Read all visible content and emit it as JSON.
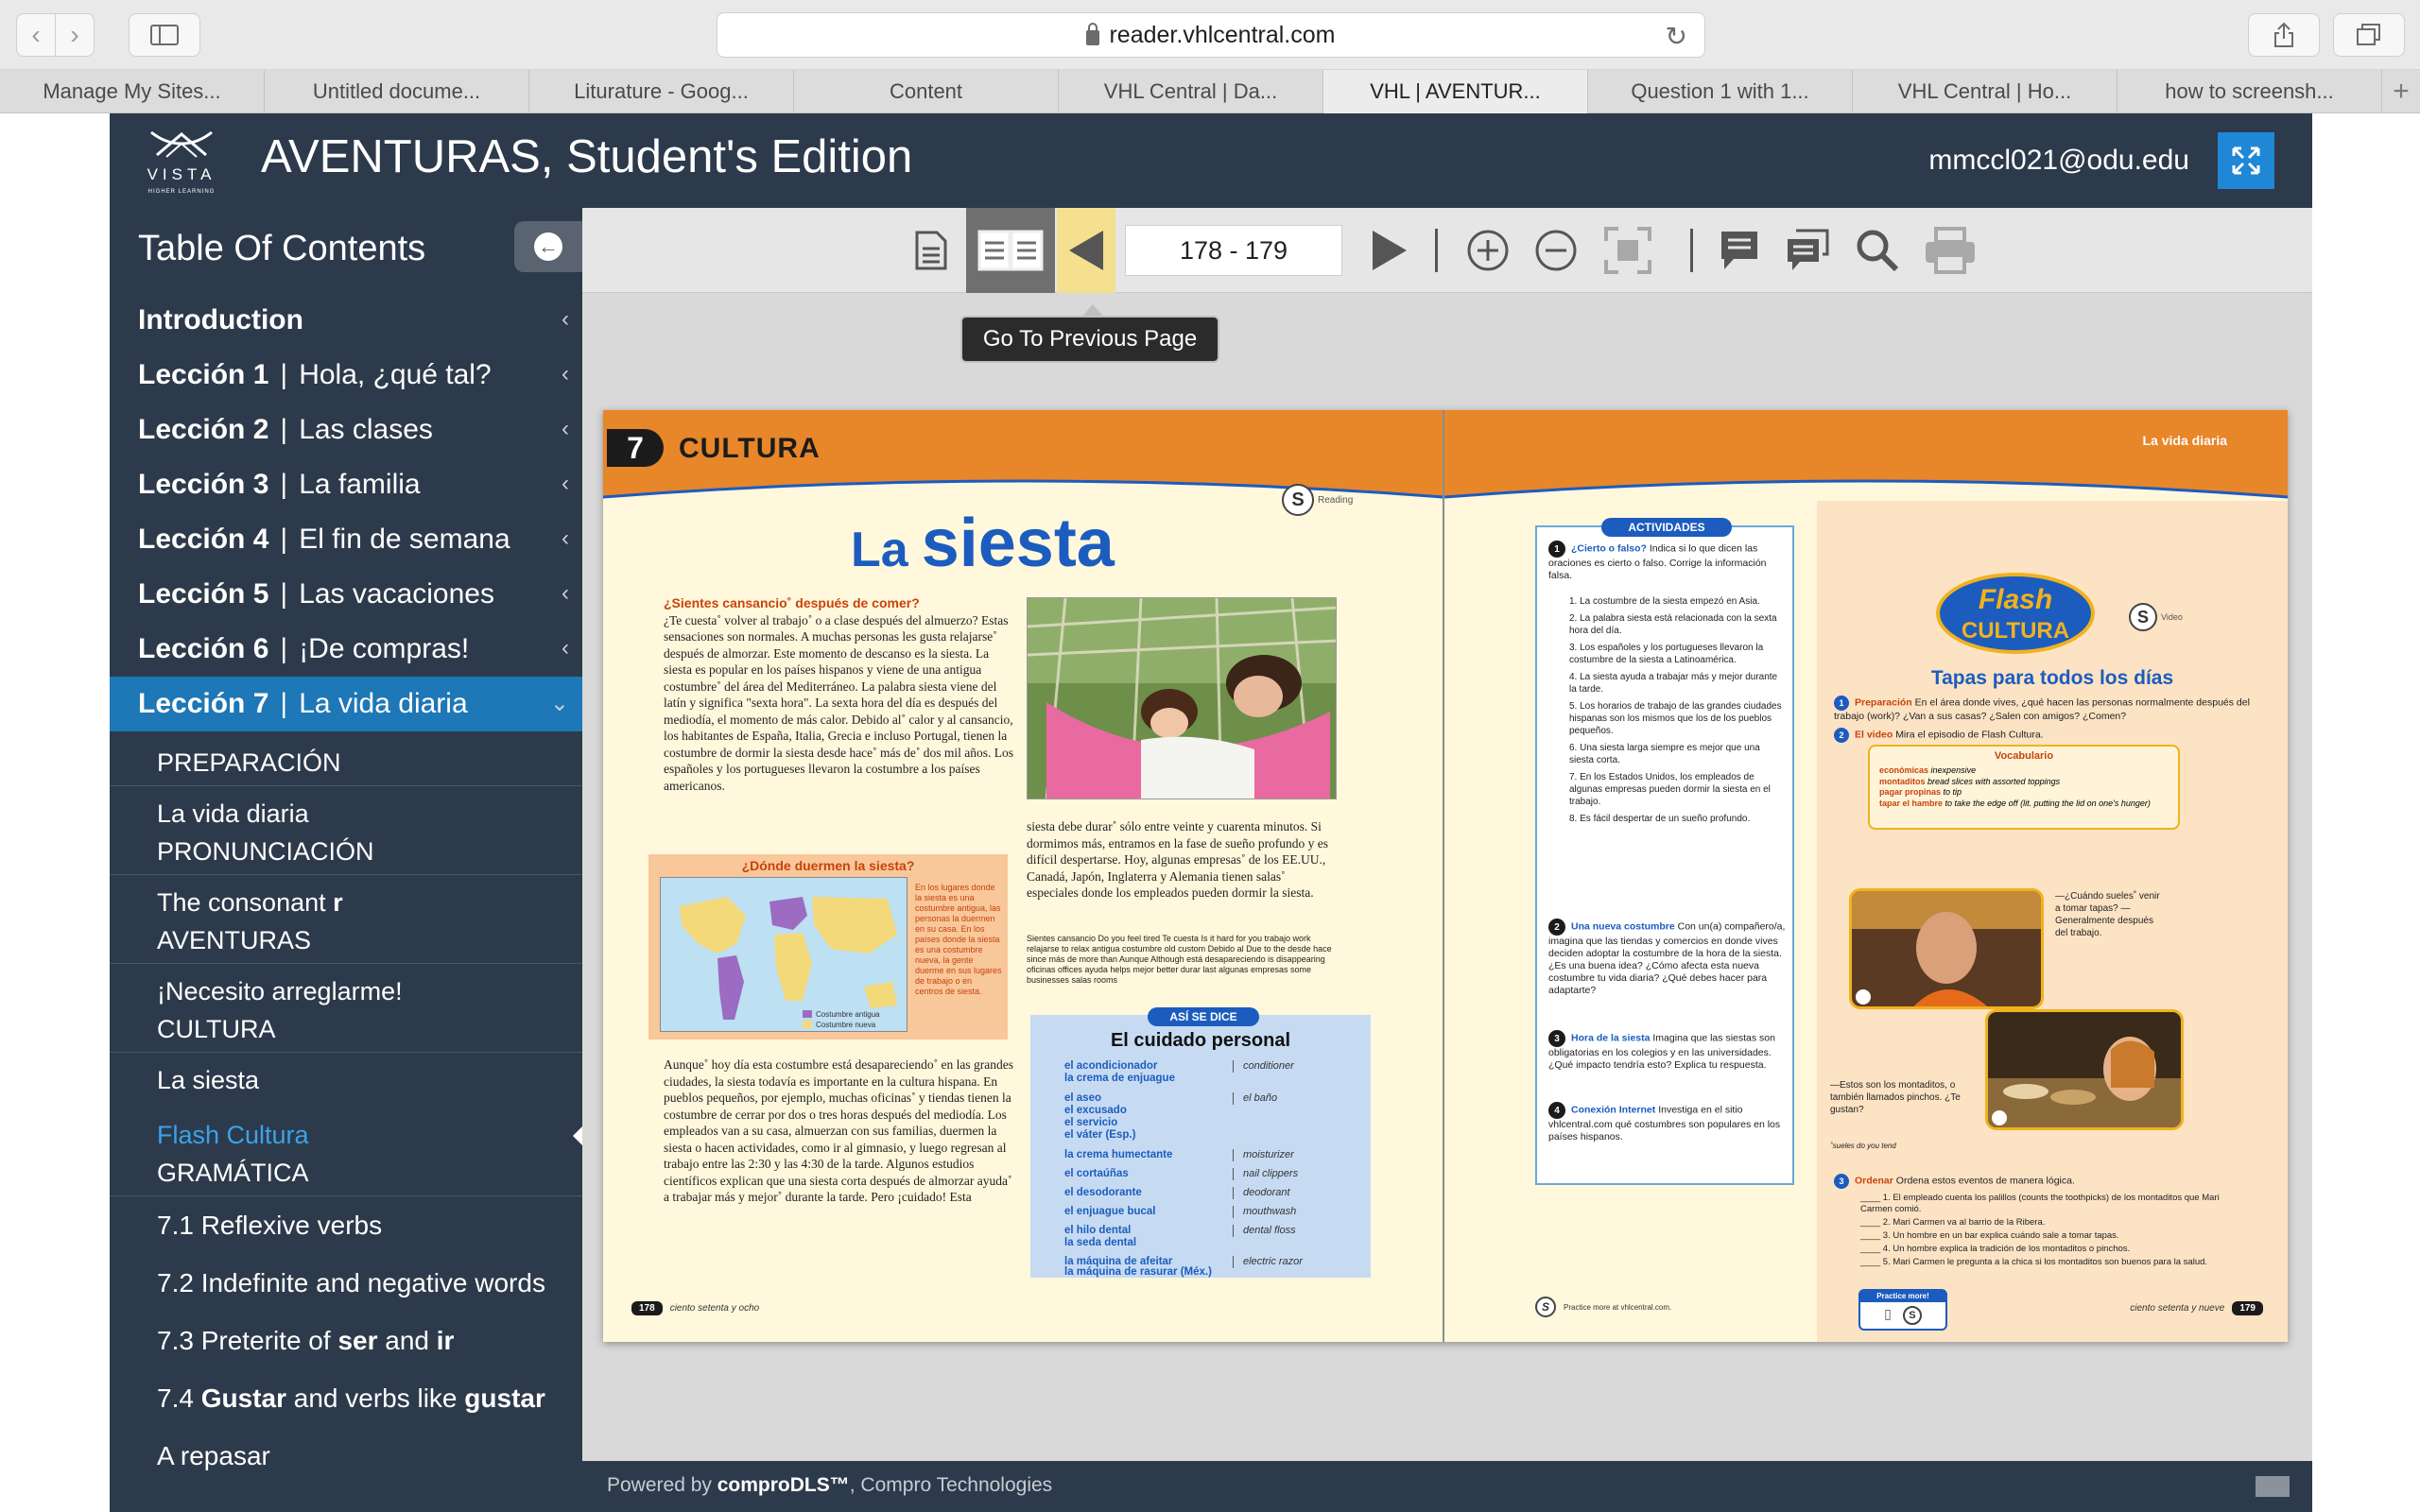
{
  "browser": {
    "url": "reader.vhlcentral.com",
    "tabs": [
      {
        "label": "Manage My Sites..."
      },
      {
        "label": "Untitled docume..."
      },
      {
        "label": "Liturature - Goog..."
      },
      {
        "label": "Content"
      },
      {
        "label": "VHL Central | Da..."
      },
      {
        "label": "VHL | AVENTUR..."
      },
      {
        "label": "Question 1 with 1..."
      },
      {
        "label": "VHL Central | Ho..."
      },
      {
        "label": "how to screensh..."
      }
    ],
    "active_tab_index": 5
  },
  "header": {
    "logo_text": "VISTA",
    "logo_subtext": "HIGHER LEARNING",
    "title": "AVENTURAS, Student's Edition",
    "user_email": "mmccl021@odu.edu"
  },
  "sidebar": {
    "title": "Table Of Contents",
    "lessons": [
      {
        "bold": "Introduction",
        "name": ""
      },
      {
        "bold": "Lección 1",
        "name": "Hola, ¿qué tal?"
      },
      {
        "bold": "Lección 2",
        "name": "Las clases"
      },
      {
        "bold": "Lección 3",
        "name": "La familia"
      },
      {
        "bold": "Lección 4",
        "name": "El fin de semana"
      },
      {
        "bold": "Lección 5",
        "name": "Las vacaciones"
      },
      {
        "bold": "Lección 6",
        "name": "¡De compras!"
      },
      {
        "bold": "Lección 7",
        "name": "La vida diaria"
      }
    ],
    "sections": {
      "preparacion": "PREPARACIÓN",
      "vida_diaria": "La vida diaria",
      "pronunciacion": "PRONUNCIACIÓN",
      "consonant_pre": "The consonant",
      "consonant_bold": "r",
      "aventuras": "AVENTURAS",
      "necesito": "¡Necesito arreglarme!",
      "cultura": "CULTURA",
      "la_siesta": "La siesta",
      "flash_cultura": "Flash Cultura",
      "gramatica": "GRAMÁTICA",
      "g71": "7.1 Reflexive verbs",
      "g72": "7.2 Indefinite and negative words",
      "g73_pre": "7.3 Preterite of",
      "g73_b1": "ser",
      "g73_mid": "and",
      "g73_b2": "ir",
      "g74_pre": "7.4",
      "g74_b1": "Gustar",
      "g74_mid": "and verbs like",
      "g74_b2": "gustar",
      "repasar": "A repasar"
    }
  },
  "reader": {
    "page_range": "178 - 179",
    "tooltip": "Go To Previous Page"
  },
  "book": {
    "left": {
      "lesson_number": "7",
      "section": "CULTURA",
      "reading_label": "Reading",
      "headline_la": "La",
      "headline_main": "siesta",
      "lead_question": "¿Sientes cansancio˚ después de comer?",
      "col1": "¿Te cuesta˚ volver al trabajo˚ o a clase después del almuerzo? Estas sensaciones son normales. A muchas personas les gusta relajarse˚ después de almorzar. Este momento de descanso es la siesta. La siesta es popular en los países hispanos y viene de una antigua costumbre˚ del área del Mediterráneo. La palabra siesta viene del latín y significa \"sexta hora\". La sexta hora del día es después del mediodía, el momento de más calor. Debido al˚ calor y al cansancio, los habitantes de España, Italia, Grecia e incluso Portugal, tienen la costumbre de dormir la siesta desde hace˚ más de˚ dos mil años. Los españoles y los portugueses llevaron la costumbre a los países americanos.",
      "col2": "siesta debe durar˚ sólo entre veinte y cuarenta minutos. Si dormimos más, entramos en la fase de sueño profundo y es difícil despertarse. Hoy, algunas empresas˚ de los EE.UU., Canadá, Japón, Inglaterra y Alemania tienen salas˚ especiales donde los empleados pueden dormir la siesta.",
      "glossary": "Sientes cansancio Do you feel tired Te cuesta Is it hard for you trabajo work relajarse to relax antigua costumbre old custom Debido al Due to the desde hace since más de more than Aunque Although está desapareciendo is disappearing oficinas offices ayuda helps mejor better durar last algunas empresas some businesses salas rooms",
      "map_title": "¿Dónde duermen la siesta?",
      "map_caption": "En los lugares donde la siesta es una costumbre antigua, las personas la duermen en su casa. En los países donde la siesta es una costumbre nueva, la gente duerme en sus lugares de trabajo o en centros de siesta.",
      "map_legend_1": "Costumbre antigua",
      "map_legend_2": "Costumbre nueva",
      "col3": "Aunque˚ hoy día esta costumbre está desapareciendo˚ en las grandes ciudades, la siesta todavía es importante en la cultura hispana. En pueblos pequeños, por ejemplo, muchas oficinas˚ y tiendas tienen la costumbre de cerrar por dos o tres horas después del mediodía. Los empleados van a su casa, almuerzan con sus familias, duermen la siesta o hacen actividades, como ir al gimnasio, y luego regresan al trabajo entre las 2:30 y las 4:30 de la tarde. Algunos estudios científicos explican que una siesta corta después de almorzar ayuda˚ a trabajar más y mejor˚ durante la tarde. Pero ¡cuidado! Esta",
      "asi_tag": "ASÍ SE DICE",
      "asi_title": "El cuidado personal",
      "asi_rows": [
        {
          "es": "el acondicionador",
          "en": "conditioner"
        },
        {
          "es": "la crema de enjuague",
          "en": ""
        },
        {
          "es": "el aseo",
          "en": "el baño"
        },
        {
          "es": "el excusado",
          "en": ""
        },
        {
          "es": "el servicio",
          "en": ""
        },
        {
          "es": "el váter (Esp.)",
          "en": ""
        },
        {
          "es": "la crema humectante",
          "en": "moisturizer"
        },
        {
          "es": "el cortaúñas",
          "en": "nail clippers"
        },
        {
          "es": "el desodorante",
          "en": "deodorant"
        },
        {
          "es": "el enjuague bucal",
          "en": "mouthwash"
        },
        {
          "es": "el hilo dental",
          "en": "dental floss"
        },
        {
          "es": "la seda dental",
          "en": ""
        },
        {
          "es": "la máquina de afeitar",
          "en": "electric razor"
        },
        {
          "es": "la máquina de rasurar (Méx.)",
          "en": ""
        }
      ],
      "page_number": "178",
      "page_words": "ciento setenta y ocho"
    },
    "right": {
      "band_title": "La vida diaria",
      "actividades_tag": "ACTIVIDADES",
      "act1_title": "¿Cierto o falso?",
      "act1_text": "Indica si lo que dicen las oraciones es cierto o falso. Corrige la información falsa.",
      "act1_items": [
        "1. La costumbre de la siesta empezó en Asia.",
        "2. La palabra siesta está relacionada con la sexta hora del día.",
        "3. Los españoles y los portugueses llevaron la costumbre de la siesta a Latinoamérica.",
        "4. La siesta ayuda a trabajar más y mejor durante la tarde.",
        "5. Los horarios de trabajo de las grandes ciudades hispanas son los mismos que los de los pueblos pequeños.",
        "6. Una siesta larga siempre es mejor que una siesta corta.",
        "7. En los Estados Unidos, los empleados de algunas empresas pueden dormir la siesta en el trabajo.",
        "8. Es fácil despertar de un sueño profundo."
      ],
      "act2_title": "Una nueva costumbre",
      "act2_text": "Con un(a) compañero/a, imagina que las tiendas y comercios en donde vives deciden adoptar la costumbre de la hora de la siesta. ¿Es una buena idea? ¿Cómo afecta esta nueva costumbre tu vida diaria? ¿Qué debes hacer para adaptarte?",
      "act3_title": "Hora de la siesta",
      "act3_text": "Imagina que las siestas son obligatorias en los colegios y en las universidades. ¿Qué impacto tendría esto? Explica tu respuesta.",
      "act4_title": "Conexión Internet",
      "act4_text": "Investiga en el sitio vhlcentral.com qué costumbres son populares en los países hispanos.",
      "practice_note": "Practice more at vhlcentral.com.",
      "flash_logo_1": "Flash",
      "flash_logo_2": "CULTURA",
      "video_label": "Video",
      "flash_title": "Tapas para todos los días",
      "prep_title": "Preparación",
      "prep_text": "En el área donde vives, ¿qué hacen las personas normalmente después del trabajo (work)? ¿Van a sus casas? ¿Salen con amigos? ¿Comen?",
      "video_title": "El video",
      "video_text": "Mira el episodio de Flash Cultura.",
      "vocab_title": "Vocabulario",
      "vocab_rows": [
        {
          "es": "económicas",
          "en": "inexpensive"
        },
        {
          "es": "montaditos",
          "en": "bread slices with assorted toppings"
        },
        {
          "es": "pagar propinas",
          "en": "to tip"
        },
        {
          "es": "tapar el hambre",
          "en": "to take the edge off (lit. putting the lid on one's hunger)"
        }
      ],
      "quote1": "—¿Cuándo sueles˚ venir a tomar tapas? —Generalmente después del trabajo.",
      "quote2": "—Estos son los montaditos, o también llamados pinchos. ¿Te gustan?",
      "suele_note": "˚sueles do you tend",
      "orden_title": "Ordenar",
      "orden_text": "Ordena estos eventos de manera lógica.",
      "orden_items": [
        "1. El empleado cuenta los palillos (counts the toothpicks) de los montaditos que Mari Carmen comió.",
        "2. Mari Carmen va al barrio de la Ribera.",
        "3. Un hombre en un bar explica cuándo sale a tomar tapas.",
        "4. Un hombre explica la tradición de los montaditos o pinchos.",
        "5. Mari Carmen le pregunta a la chica si los montaditos son buenos para la salud."
      ],
      "practice_more": "Practice more!",
      "page_number": "179",
      "page_words": "ciento setenta y nueve"
    }
  },
  "footer": {
    "powered_by": "Powered by",
    "brand": "comproDLS™",
    "company": ", Compro Technologies"
  },
  "colors": {
    "app_dark": "#2d3a4b",
    "accent_blue": "#1e77b6",
    "highlight_yellow": "#f4e08f",
    "book_orange": "#e8862a",
    "book_blue": "#1c5cbf"
  }
}
